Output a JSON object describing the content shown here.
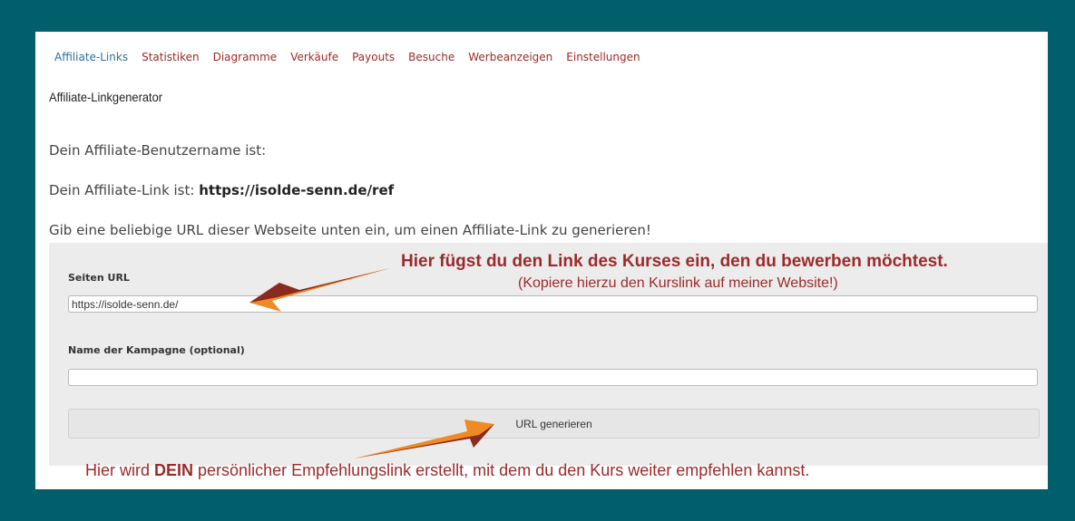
{
  "nav": {
    "items": [
      {
        "label": "Affiliate-Links"
      },
      {
        "label": "Statistiken"
      },
      {
        "label": "Diagramme"
      },
      {
        "label": "Verkäufe"
      },
      {
        "label": "Payouts"
      },
      {
        "label": "Besuche"
      },
      {
        "label": "Werbeanzeigen"
      },
      {
        "label": "Einstellungen"
      }
    ],
    "first_color": "#2e6f9e",
    "link_color": "#9c2a2a"
  },
  "page": {
    "subtitle": "Affiliate-Linkgenerator",
    "username_text": "Dein Affiliate-Benutzername ist:",
    "link_prefix": "Dein Affiliate-Link ist: ",
    "link_value": "https://isolde-senn.de/ref",
    "instruction": "Gib eine beliebige URL dieser Webseite unten ein, um einen Affiliate-Link zu generieren!"
  },
  "form": {
    "url_label": "Seiten URL",
    "url_value": "https://isolde-senn.de/",
    "campaign_label": "Name der Kampagne (optional)",
    "campaign_value": "",
    "button_label": "URL generieren"
  },
  "annotations": {
    "head": "Hier fügst du den Link des Kurses ein, den du bewerben möchtest.",
    "sub": "(Kopiere hierzu den Kurslink auf meiner Website!)",
    "bottom_prefix": "Hier wird ",
    "bottom_bold": "DEIN",
    "bottom_suffix": " persönlicher Empfehlungslink erstellt, mit dem du den Kurs weiter empfehlen kannst.",
    "color": "#9c2a2a",
    "arrow_light": "#f08a24",
    "arrow_dark": "#8b2a1e"
  },
  "colors": {
    "background": "#005f6b",
    "panel": "#ffffff",
    "form_box": "#ececec"
  }
}
